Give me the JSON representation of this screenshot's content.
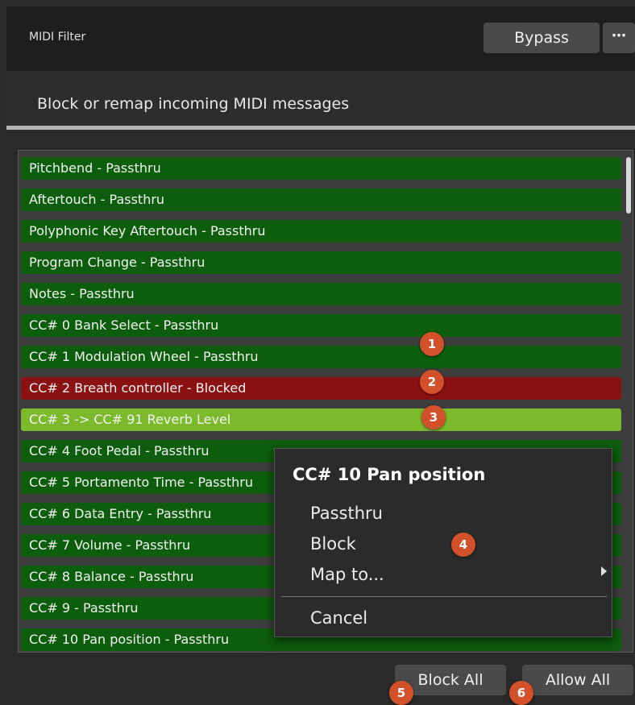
{
  "header": {
    "title": "MIDI Filter",
    "bypass_label": "Bypass",
    "more_icon": "⋯"
  },
  "subtitle": "Block or remap incoming MIDI messages",
  "rows": [
    {
      "label": "Pitchbend - Passthru",
      "state": "passthru"
    },
    {
      "label": "Aftertouch - Passthru",
      "state": "passthru"
    },
    {
      "label": "Polyphonic Key Aftertouch - Passthru",
      "state": "passthru"
    },
    {
      "label": "Program Change - Passthru",
      "state": "passthru"
    },
    {
      "label": "Notes - Passthru",
      "state": "passthru"
    },
    {
      "label": "CC# 0 Bank Select - Passthru",
      "state": "passthru"
    },
    {
      "label": "CC# 1 Modulation Wheel - Passthru",
      "state": "passthru"
    },
    {
      "label": "CC# 2 Breath controller - Blocked",
      "state": "blocked"
    },
    {
      "label": "CC# 3 -> CC# 91 Reverb Level",
      "state": "mapped"
    },
    {
      "label": "CC# 4 Foot Pedal - Passthru",
      "state": "passthru"
    },
    {
      "label": "CC# 5 Portamento Time - Passthru",
      "state": "passthru"
    },
    {
      "label": "CC# 6 Data Entry - Passthru",
      "state": "passthru"
    },
    {
      "label": "CC# 7 Volume - Passthru",
      "state": "passthru"
    },
    {
      "label": "CC# 8 Balance - Passthru",
      "state": "passthru"
    },
    {
      "label": "CC# 9 - Passthru",
      "state": "passthru"
    },
    {
      "label": "CC# 10 Pan position - Passthru",
      "state": "passthru"
    }
  ],
  "context_menu": {
    "title": "CC# 10 Pan position",
    "items": [
      "Passthru",
      "Block",
      "Map to...",
      "Cancel"
    ]
  },
  "footer": {
    "block_all": "Block All",
    "allow_all": "Allow All"
  },
  "badges": [
    "1",
    "2",
    "3",
    "4",
    "5",
    "6"
  ],
  "colors": {
    "passthru": "#0c5e0c",
    "blocked": "#8b1212",
    "mapped": "#7cba2c",
    "badge": "#d2502a"
  }
}
